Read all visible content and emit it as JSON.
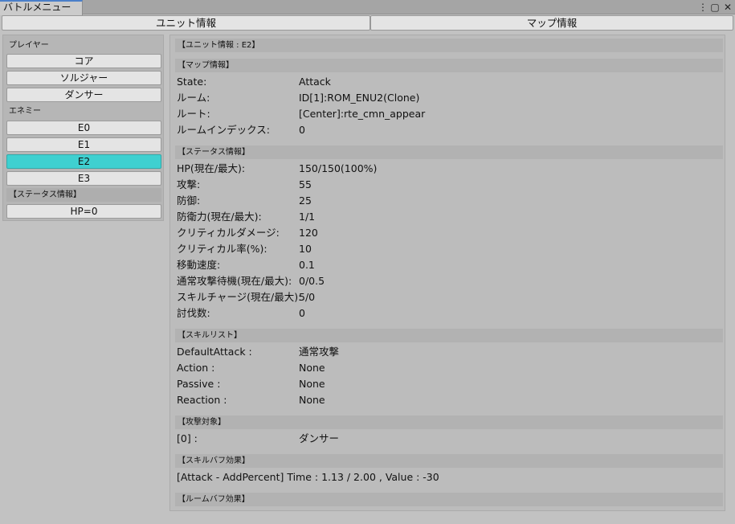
{
  "window": {
    "tab_label": "バトルメニュー",
    "controls": {
      "menu": "⋮",
      "maximize": "▢",
      "close": "✕"
    }
  },
  "toolbar": {
    "unit_info": "ユニット情報",
    "map_info": "マップ情報"
  },
  "left": {
    "player_header": "プレイヤー",
    "player_buttons": [
      "コア",
      "ソルジャー",
      "ダンサー"
    ],
    "enemy_header": "エネミー",
    "enemy_buttons": [
      "E0",
      "E1",
      "E2",
      "E3"
    ],
    "selected_enemy": "E2",
    "status_header": "【ステータス情報】",
    "status_buttons": [
      "HP=0"
    ]
  },
  "right": {
    "title": "【ユニット情報 : E2】",
    "map_section": {
      "header": "【マップ情報】",
      "rows": [
        {
          "k": "State:",
          "v": "Attack"
        },
        {
          "k": "ルーム:",
          "v": "ID[1]:ROM_ENU2(Clone)"
        },
        {
          "k": "ルート:",
          "v": "[Center]:rte_cmn_appear"
        },
        {
          "k": "ルームインデックス:",
          "v": "0"
        }
      ]
    },
    "status_section": {
      "header": "【ステータス情報】",
      "rows": [
        {
          "k": "HP(現在/最大):",
          "v": "150/150(100%)"
        },
        {
          "k": "攻撃:",
          "v": "55"
        },
        {
          "k": "防御:",
          "v": "25"
        },
        {
          "k": "防衛力(現在/最大):",
          "v": "1/1"
        },
        {
          "k": "クリティカルダメージ:",
          "v": "120"
        },
        {
          "k": "クリティカル率(%):",
          "v": "10"
        },
        {
          "k": "移動速度:",
          "v": "0.1"
        },
        {
          "k": "通常攻撃待機(現在/最大):",
          "v": "0/0.5"
        },
        {
          "k": "スキルチャージ(現在/最大):",
          "v": "5/0"
        },
        {
          "k": "討伐数:",
          "v": "0"
        }
      ]
    },
    "skill_section": {
      "header": "【スキルリスト】",
      "rows": [
        {
          "k": "DefaultAttack :",
          "v": "通常攻撃"
        },
        {
          "k": "Action :",
          "v": "None"
        },
        {
          "k": "Passive :",
          "v": "None"
        },
        {
          "k": "Reaction :",
          "v": "None"
        }
      ]
    },
    "target_section": {
      "header": "【攻撃対象】",
      "rows": [
        {
          "k": "[0] :",
          "v": "ダンサー"
        }
      ]
    },
    "skillbuff_section": {
      "header": "【スキルバフ効果】",
      "line": "[Attack - AddPercent] Time : 1.13 / 2.00 , Value : -30"
    },
    "roombuff_section": {
      "header": "【ルームバフ効果】"
    }
  },
  "colors": {
    "selected": "#3fd0d0",
    "tab_accent": "#4b7fc9"
  }
}
